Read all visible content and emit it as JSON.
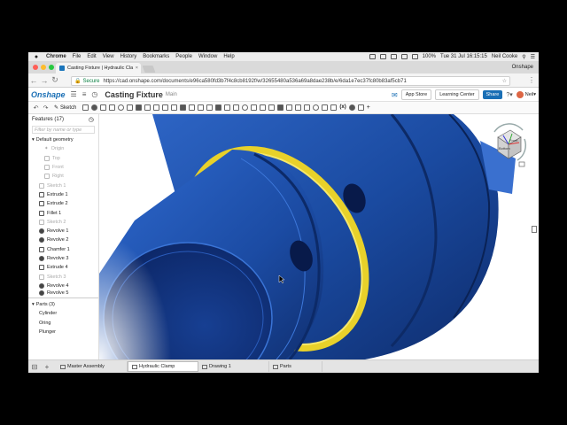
{
  "macos": {
    "apple": "",
    "app": "Chrome",
    "menus": [
      "File",
      "Edit",
      "View",
      "History",
      "Bookmarks",
      "People",
      "Window",
      "Help"
    ],
    "battery": "100%",
    "datetime": "Tue 31 Jul  16:15:15",
    "user": "Neil Cooke"
  },
  "browser": {
    "tab_title": "Casting Fixture | Hydraulic Cla",
    "tab_close": "×",
    "profile": "Onshape",
    "secure": "Secure",
    "url": "https://cad.onshape.com/documents/e96ca580fd3b7f4c8cb8192f/w/32655480a536a69a8dae238b/e/6da1e7ec37fc80b83af5cb71",
    "back": "←",
    "forward": "→",
    "reload": "↻",
    "star": "☆",
    "menu": "⋮",
    "colors": {
      "close": "#ff5f57",
      "minimize": "#febc2e",
      "maximize": "#28c840"
    }
  },
  "header": {
    "logo": "Onshape",
    "document_title": "Casting Fixture",
    "branch": "Main",
    "app_store": "App Store",
    "learning_center": "Learning Center",
    "share": "Share",
    "help": "?▾",
    "user": "Neil▾",
    "accent": "#1a6fb5"
  },
  "toolbar": {
    "undo": "↶",
    "redo": "↷",
    "sketch": "Sketch",
    "variable": "(x)"
  },
  "features": {
    "header": "Features (17)",
    "filter_placeholder": "Filter by name or type",
    "items": [
      {
        "label": "Default geometry",
        "state": "normal",
        "level": 0,
        "icon": "chevron-down"
      },
      {
        "label": "Origin",
        "state": "grey",
        "level": 2,
        "icon": "origin"
      },
      {
        "label": "Top",
        "state": "grey",
        "level": 2,
        "icon": "plane"
      },
      {
        "label": "Front",
        "state": "grey",
        "level": 2,
        "icon": "plane"
      },
      {
        "label": "Right",
        "state": "grey",
        "level": 2,
        "icon": "plane"
      },
      {
        "label": "Sketch 1",
        "state": "grey",
        "level": 1,
        "icon": "sketch"
      },
      {
        "label": "Extrude 1",
        "state": "normal",
        "level": 1,
        "icon": "extrude"
      },
      {
        "label": "Extrude 2",
        "state": "normal",
        "level": 1,
        "icon": "extrude"
      },
      {
        "label": "Fillet 1",
        "state": "normal",
        "level": 1,
        "icon": "fillet"
      },
      {
        "label": "Sketch 2",
        "state": "grey",
        "level": 1,
        "icon": "sketch"
      },
      {
        "label": "Revolve 1",
        "state": "normal",
        "level": 1,
        "icon": "revolve"
      },
      {
        "label": "Revolve 2",
        "state": "normal",
        "level": 1,
        "icon": "revolve"
      },
      {
        "label": "Chamfer 1",
        "state": "normal",
        "level": 1,
        "icon": "chamfer"
      },
      {
        "label": "Revolve 3",
        "state": "normal",
        "level": 1,
        "icon": "revolve"
      },
      {
        "label": "Extrude 4",
        "state": "normal",
        "level": 1,
        "icon": "extrude"
      },
      {
        "label": "Sketch 3",
        "state": "grey",
        "level": 1,
        "icon": "sketch"
      },
      {
        "label": "Revolve 4",
        "state": "normal",
        "level": 1,
        "icon": "revolve"
      },
      {
        "label": "Revolve 5",
        "state": "normal",
        "level": 1,
        "icon": "revolve"
      }
    ]
  },
  "parts": {
    "header": "Parts (3)",
    "items": [
      "Cylinder",
      "Oring",
      "Plunger"
    ]
  },
  "viewport": {
    "viewcube_front": "Front",
    "viewcube_bottom": "Bottom",
    "body_color": "#1a4fa8",
    "ring_color": "#e8d12a"
  },
  "bottom_tabs": [
    {
      "label": "Master Assembly",
      "icon": "assembly-icon",
      "active": false
    },
    {
      "label": "Hydraulic Clamp",
      "icon": "partstudio-icon",
      "active": true
    },
    {
      "label": "Drawing 1",
      "icon": "drawing-icon",
      "active": false
    },
    {
      "label": "Parts",
      "icon": "folder-icon",
      "active": false
    }
  ],
  "bottom_icons": {
    "tabs_list": "⊟",
    "add": "+"
  }
}
